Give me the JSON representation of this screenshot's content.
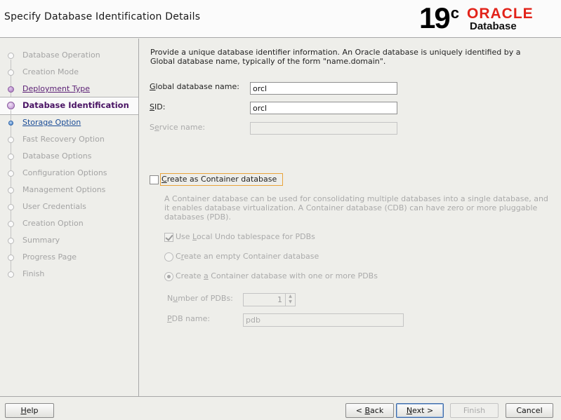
{
  "header": {
    "title": "Specify Database Identification Details",
    "logo": {
      "version": "19",
      "version_sup": "c",
      "brand": "ORACLE",
      "product": "Database",
      "brand_color": "#e2231a"
    }
  },
  "steps": [
    {
      "label": "Database Operation",
      "state": "pending"
    },
    {
      "label": "Creation Mode",
      "state": "pending"
    },
    {
      "label": "Deployment Type",
      "state": "done"
    },
    {
      "label": "Database Identification",
      "state": "current"
    },
    {
      "label": "Storage Option",
      "state": "link"
    },
    {
      "label": "Fast Recovery Option",
      "state": "pending"
    },
    {
      "label": "Database Options",
      "state": "pending"
    },
    {
      "label": "Configuration Options",
      "state": "pending"
    },
    {
      "label": "Management Options",
      "state": "pending"
    },
    {
      "label": "User Credentials",
      "state": "pending"
    },
    {
      "label": "Creation Option",
      "state": "pending"
    },
    {
      "label": "Summary",
      "state": "pending"
    },
    {
      "label": "Progress Page",
      "state": "pending"
    },
    {
      "label": "Finish",
      "state": "pending"
    }
  ],
  "form": {
    "intro": "Provide a unique database identifier information. An Oracle database is uniquely identified by a Global database name, typically of the form \"name.domain\".",
    "global_name": {
      "mnemonic": "G",
      "rest": "lobal database name:",
      "value": "orcl"
    },
    "sid": {
      "mnemonic": "S",
      "rest": "ID:",
      "value": "orcl"
    },
    "service": {
      "label_a": "S",
      "label_mnemonic": "e",
      "label_b": "rvice name:",
      "value": ""
    },
    "container": {
      "mnemonic": "C",
      "rest": "reate as Container database",
      "checked": false,
      "description": "A Container database can be used for consolidating multiple databases into a single database, and it enables database virtualization. A Container database (CDB) can have zero or more pluggable databases (PDB).",
      "local_undo": {
        "a": "Use ",
        "mnemonic": "L",
        "b": "ocal Undo tablespace for PDBs",
        "checked": true
      },
      "empty": {
        "a": "C",
        "mnemonic": "r",
        "b": "eate an empty Container database",
        "selected": false
      },
      "with_pdbs": {
        "a": "Create ",
        "mnemonic": "a",
        "b": " Container database with one or more PDBs",
        "selected": true
      },
      "num_pdbs": {
        "a": "N",
        "mnemonic": "u",
        "b": "mber of PDBs:",
        "value": "1",
        "up_icon": "▲",
        "down_icon": "▼"
      },
      "pdb_name": {
        "mnemonic": "P",
        "rest": "DB name:",
        "value": "pdb"
      }
    }
  },
  "buttons": {
    "help": {
      "mnemonic": "H",
      "rest": "elp"
    },
    "back": {
      "pre": "< ",
      "mnemonic": "B",
      "rest": "ack"
    },
    "next": {
      "mnemonic": "N",
      "rest": "ext >"
    },
    "finish": {
      "label": "Finish"
    },
    "cancel": {
      "label": "Cancel"
    }
  }
}
